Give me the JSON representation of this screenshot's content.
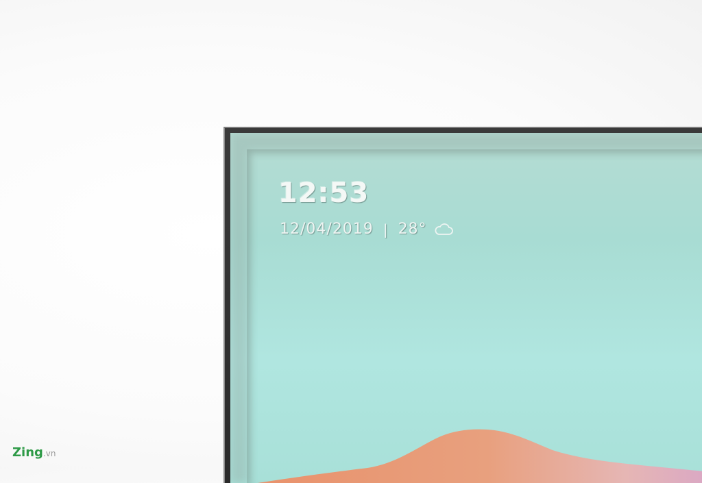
{
  "screen": {
    "time": "12:53",
    "date": "12/04/2019",
    "separator": "|",
    "temperature": "28°",
    "weather_icon": "cloud-icon"
  },
  "watermark": {
    "brand": "Zing",
    "suffix": ".vn"
  },
  "colors": {
    "screen_bg": "#aedfd8",
    "mountain": "#e49a7a",
    "frame": "#2f2f2f",
    "logo_green": "#2e9a47"
  }
}
